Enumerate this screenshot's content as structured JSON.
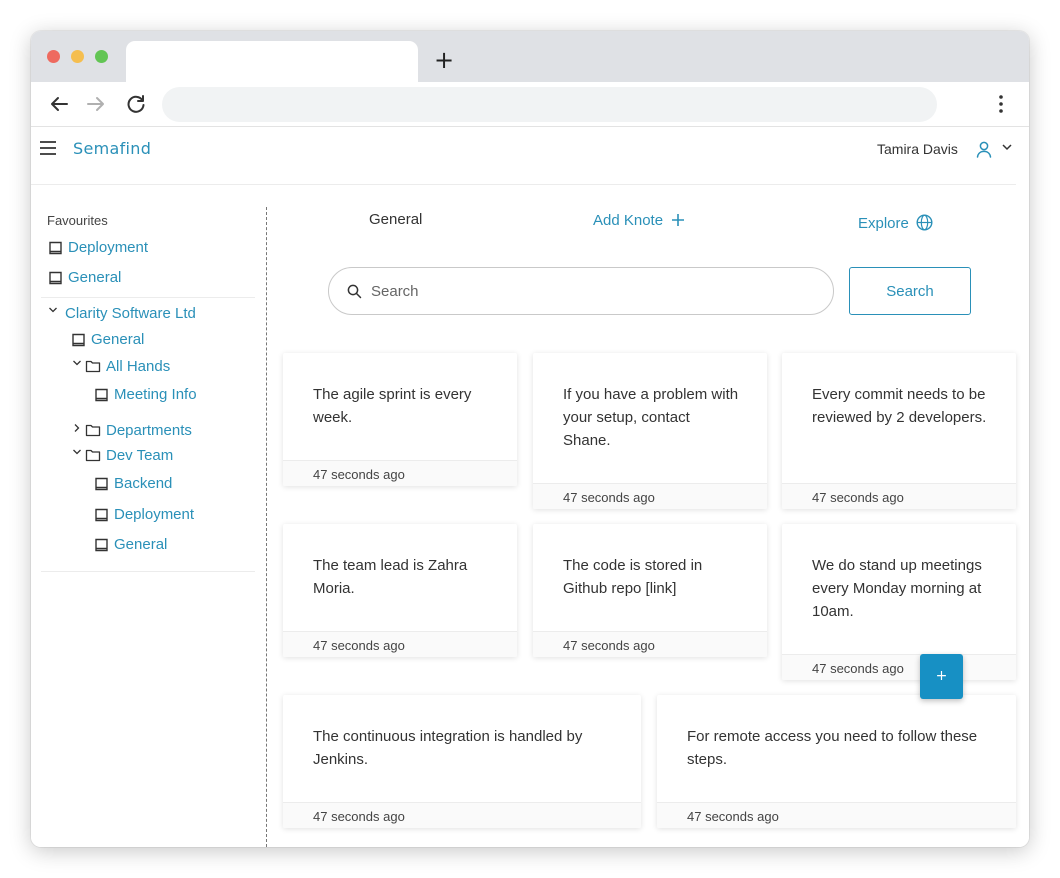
{
  "browser": {
    "new_tab_symbol": "+",
    "traffic_lights": [
      "#ee6a5f",
      "#f5be4f",
      "#62c554"
    ]
  },
  "app": {
    "brand": "Semafind",
    "user_name": "Tamira Davis",
    "accent_color": "#2a90b8"
  },
  "sidebar": {
    "favourites_title": "Favourites",
    "favourites": [
      {
        "label": "Deployment",
        "icon": "book-icon"
      },
      {
        "label": "General",
        "icon": "book-icon"
      }
    ],
    "tree": {
      "org": "Clarity Software Ltd",
      "org_general": "General",
      "all_hands": "All Hands",
      "meeting_info": "Meeting Info",
      "departments": "Departments",
      "dev_team": "Dev Team",
      "backend": "Backend",
      "deployment": "Deployment",
      "dev_general": "General"
    }
  },
  "main": {
    "tabs": {
      "general": "General",
      "add_knote": "Add Knote",
      "explore": "Explore"
    },
    "search": {
      "placeholder": "Search",
      "button": "Search"
    },
    "cards": [
      {
        "text": "The agile sprint is every week.",
        "time": "47 seconds ago"
      },
      {
        "text": "If you have a problem with your setup, contact Shane.",
        "time": "47 seconds ago"
      },
      {
        "text": "Every commit needs to be reviewed by 2 developers.",
        "time": "47 seconds ago"
      },
      {
        "text": "The team lead is Zahra Moria.",
        "time": "47 seconds ago"
      },
      {
        "text": "The code is stored in Github repo [link]",
        "time": "47 seconds ago"
      },
      {
        "text": "We do stand up meetings every Monday morning at 10am.",
        "time": "47 seconds ago"
      },
      {
        "text": "The continuous integration is handled by Jenkins.",
        "time": "47 seconds ago"
      },
      {
        "text": "For remote access you need to follow these steps.",
        "time": "47 seconds ago"
      }
    ],
    "fab_label": "+"
  }
}
